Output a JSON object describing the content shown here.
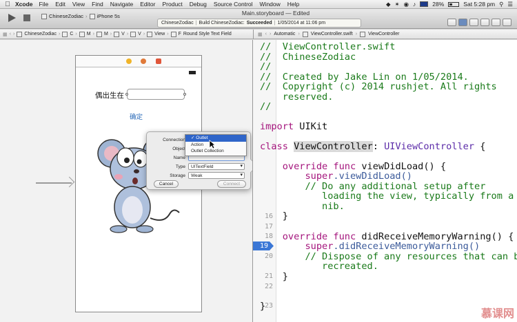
{
  "menubar": {
    "app": "Xcode",
    "menus": [
      "File",
      "Edit",
      "View",
      "Find",
      "Navigate",
      "Editor",
      "Product",
      "Debug",
      "Source Control",
      "Window",
      "Help"
    ],
    "battery": "28%",
    "clock": "Sat 5:28 pm"
  },
  "toolbar": {
    "scheme": "ChineseZodiac",
    "device": "iPhone 5s",
    "window_title": "Main.storyboard — Edited",
    "status_project": "ChineseZodiac",
    "status_build": "Build ChineseZodiac:",
    "status_result": "Succeeded",
    "status_time": "1/05/2014 at 11:06 pm"
  },
  "jumpbar_left": {
    "items": [
      "ChineseZodiac",
      "C",
      "M",
      "M",
      "V",
      "V",
      "View",
      "F",
      "Round Style Text Field"
    ]
  },
  "jumpbar_right": {
    "items": [
      "Automatic",
      "ViewController.swift",
      "ViewController"
    ]
  },
  "scene": {
    "label_birth": "偶出生在",
    "button_confirm": "确定"
  },
  "popover": {
    "connection_label": "Connection",
    "object_label": "Object",
    "name_label": "Name",
    "type_label": "Type",
    "type_value": "UITextField",
    "storage_label": "Storage",
    "storage_value": "Weak",
    "cancel": "Cancel",
    "connect": "Connect",
    "options": [
      "Outlet",
      "Action",
      "Outlet Collection"
    ],
    "selected_option": "Outlet"
  },
  "editor": {
    "line_numbers": [
      "16",
      "17",
      "18",
      "19",
      "20",
      "21",
      "22",
      "23"
    ],
    "breakpoint_line": "19",
    "code": {
      "l1": "//  ViewController.swift",
      "l2": "//  ChineseZodiac",
      "l3": "//",
      "l4": "//  Created by Jake Lin on 1/05/2014.",
      "l5a": "//  Copyright (c) 2014 rushjet. All rights",
      "l5b": "    reserved.",
      "l6": "//",
      "import_kw": "import",
      "import_mod": " UIKit",
      "class_kw": "class",
      "class_name": "ViewController",
      "class_sep": ": ",
      "class_super": "UIViewController",
      "class_brace": " {",
      "ov1_kw": "override func",
      "ov1_fn": " viewDidLoad",
      "ov1_rest": "() {",
      "super1_kw": "super",
      "super1_rest": ".viewDidLoad()",
      "cm1a": "// Do any additional setup after",
      "cm1b": "   loading the view, typically from a",
      "cm1c": "   nib.",
      "close1": "}",
      "ov2_kw": "override func",
      "ov2_fn": " didReceiveMemoryWarning",
      "ov2_rest": "() {",
      "super2_kw": "super",
      "super2_rest": ".didReceiveMemoryWarning()",
      "cm2a": "// Dispose of any resources that can be",
      "cm2b": "   recreated.",
      "close2": "}",
      "close3": "}"
    }
  },
  "watermark": "慕课网"
}
